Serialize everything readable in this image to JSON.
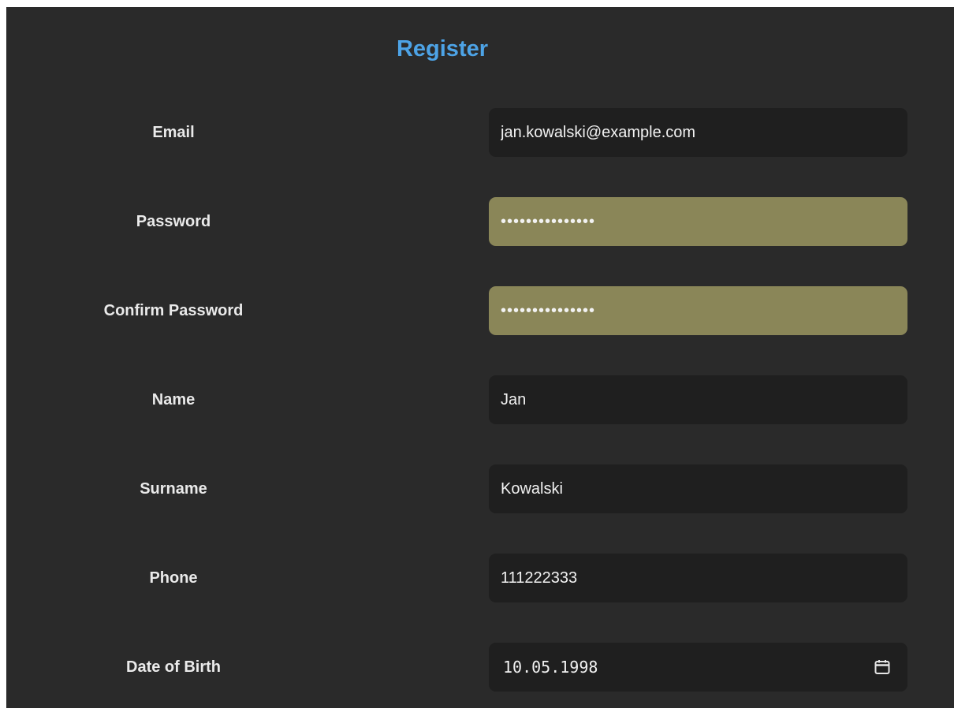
{
  "form": {
    "title": "Register",
    "fields": {
      "email": {
        "label": "Email",
        "value": "jan.kowalski@example.com"
      },
      "password": {
        "label": "Password",
        "value": "password12345ab",
        "autofilled": true
      },
      "confirm_password": {
        "label": "Confirm Password",
        "value": "password12345ab",
        "autofilled": true
      },
      "name": {
        "label": "Name",
        "value": "Jan"
      },
      "surname": {
        "label": "Surname",
        "value": "Kowalski"
      },
      "phone": {
        "label": "Phone",
        "value": "111222333"
      },
      "date_of_birth": {
        "label": "Date of Birth",
        "value": "10.05.1998",
        "icon": "calendar-icon"
      }
    }
  },
  "colors": {
    "background": "#2a2a2a",
    "title": "#4da3e6",
    "input_background": "#1f1f1f",
    "autofill_background": "#8a8658",
    "text": "#eaeaea"
  }
}
